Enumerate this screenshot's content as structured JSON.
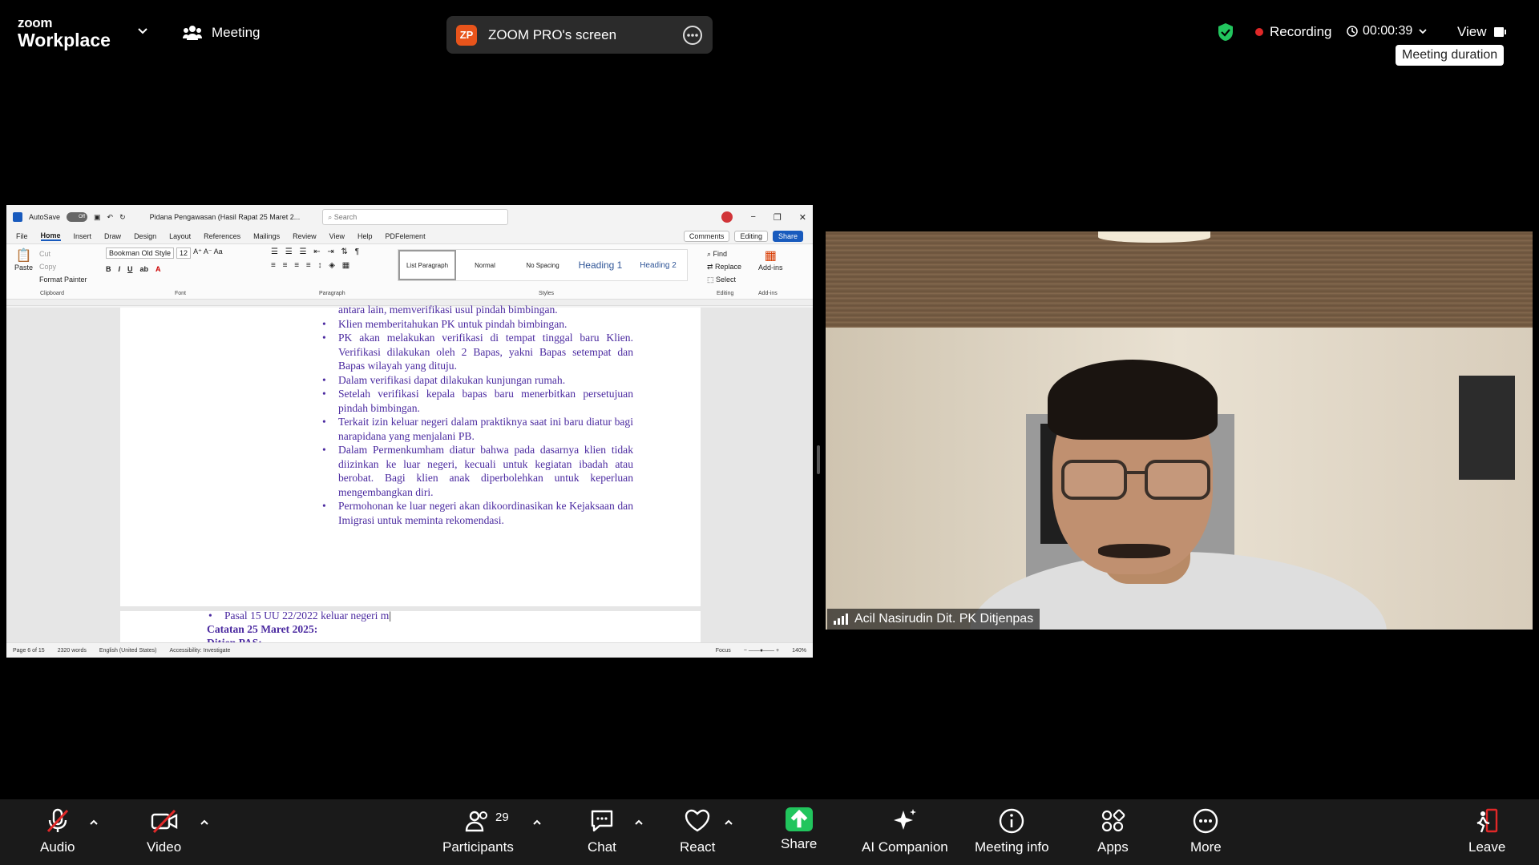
{
  "topbar": {
    "brand_top": "zoom",
    "brand_bottom": "Workplace",
    "meeting_label": "Meeting",
    "screen_badge": "ZP",
    "screen_label": "ZOOM PRO's screen",
    "recording_label": "Recording",
    "timer": "00:00:39",
    "view_label": "View",
    "tooltip": "Meeting duration"
  },
  "word": {
    "autosave": "AutoSave",
    "autosave_state": "Off",
    "doc_title": "Pidana Pengawasan (Hasil Rapat 25 Maret 2...",
    "search_placeholder": "Search",
    "menu": [
      "File",
      "Home",
      "Insert",
      "Draw",
      "Design",
      "Layout",
      "References",
      "Mailings",
      "Review",
      "View",
      "Help",
      "PDFelement"
    ],
    "comments": "Comments",
    "editing": "Editing",
    "share": "Share",
    "ribbon": {
      "paste": "Paste",
      "cut": "Cut",
      "copy": "Copy",
      "format_painter": "Format Painter",
      "clipboard": "Clipboard",
      "font_name": "Bookman Old Style",
      "font_size": "12",
      "font_group": "Font",
      "paragraph_group": "Paragraph",
      "styles_group": "Styles",
      "styles": [
        "List Paragraph",
        "Normal",
        "No Spacing",
        "Heading 1",
        "Heading 2"
      ],
      "find": "Find",
      "replace": "Replace",
      "select": "Select",
      "editing_group": "Editing",
      "addins": "Add-ins"
    },
    "body_partial": "antara lain, memverifikasi usul pindah bimbingan.",
    "bullets": [
      "Klien memberitahukan PK untuk pindah bimbingan.",
      "PK akan melakukan verifikasi di tempat tinggal baru Klien. Verifikasi dilakukan oleh 2 Bapas, yakni Bapas setempat dan Bapas wilayah yang dituju.",
      "Dalam verifikasi dapat dilakukan kunjungan rumah.",
      "Setelah verifikasi kepala bapas baru menerbitkan persetujuan pindah bimbingan.",
      "Terkait izin keluar negeri dalam praktiknya saat ini baru diatur bagi narapidana yang menjalani PB.",
      "Dalam Permenkumham diatur bahwa pada dasarnya klien tidak diizinkan ke luar negeri, kecuali untuk kegiatan ibadah atau berobat. Bagi klien anak diperbolehkan untuk keperluan mengembangkan diri.",
      "Permohonan ke luar negeri akan dikoordinasikan ke Kejaksaan dan Imigrasi untuk meminta rekomendasi."
    ],
    "page2_bullet": "Pasal 15 UU 22/2022 keluar negeri m",
    "page2_heading": "Catatan 25 Maret 2025:",
    "page2_sub": "Ditjen PAS:",
    "status": {
      "page": "Page 6 of 15",
      "words": "2320 words",
      "language": "English (United States)",
      "accessibility": "Accessibility: Investigate",
      "focus": "Focus",
      "zoom": "140%"
    }
  },
  "participant": {
    "name": "Acil Nasirudin Dit. PK Ditjenpas"
  },
  "toolbar": {
    "audio": "Audio",
    "video": "Video",
    "participants": "Participants",
    "participants_count": "29",
    "chat": "Chat",
    "react": "React",
    "share": "Share",
    "ai_companion": "AI Companion",
    "meeting_info": "Meeting info",
    "apps": "Apps",
    "more": "More",
    "leave": "Leave"
  },
  "colors": {
    "recording": "#e02828",
    "share_green": "#21c55d",
    "shield_green": "#22c55e",
    "zp_badge": "#e8541b",
    "doc_text": "#4b2aa0",
    "word_blue": "#185abd"
  }
}
